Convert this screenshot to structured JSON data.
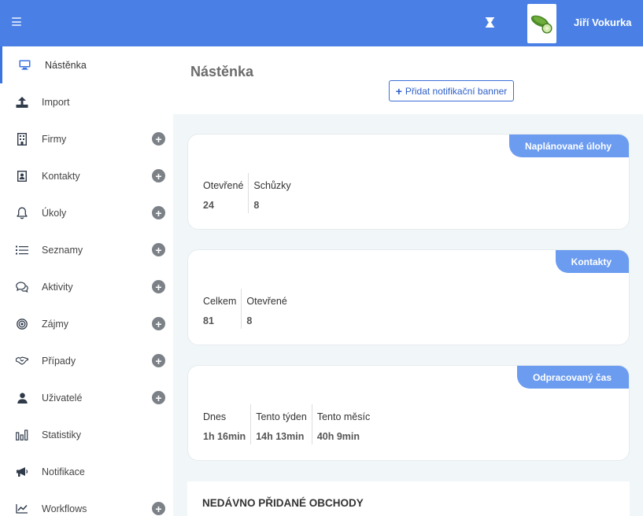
{
  "header": {
    "user_name": "Jiří Vokurka",
    "brand_color": "#4a80e6",
    "icons": [
      "menu-icon",
      "hourglass-icon",
      "avatar-cucumber-icon"
    ]
  },
  "sidebar": {
    "items": [
      {
        "label": "Nástěnka",
        "icon": "monitor-icon",
        "active": true,
        "has_add": false
      },
      {
        "label": "Import",
        "icon": "upload-icon",
        "active": false,
        "has_add": false
      },
      {
        "label": "Firmy",
        "icon": "building-icon",
        "active": false,
        "has_add": true
      },
      {
        "label": "Kontakty",
        "icon": "contact-card-icon",
        "active": false,
        "has_add": true
      },
      {
        "label": "Úkoly",
        "icon": "bell-icon",
        "active": false,
        "has_add": true
      },
      {
        "label": "Seznamy",
        "icon": "list-icon",
        "active": false,
        "has_add": true
      },
      {
        "label": "Aktivity",
        "icon": "chat-icon",
        "active": false,
        "has_add": true
      },
      {
        "label": "Zájmy",
        "icon": "target-icon",
        "active": false,
        "has_add": true
      },
      {
        "label": "Případy",
        "icon": "handshake-icon",
        "active": false,
        "has_add": true
      },
      {
        "label": "Uživatelé",
        "icon": "user-icon",
        "active": false,
        "has_add": true
      },
      {
        "label": "Statistiky",
        "icon": "bar-chart-icon",
        "active": false,
        "has_add": false
      },
      {
        "label": "Notifikace",
        "icon": "megaphone-icon",
        "active": false,
        "has_add": false
      },
      {
        "label": "Workflows",
        "icon": "line-chart-icon",
        "active": false,
        "has_add": true
      }
    ]
  },
  "main": {
    "title": "Nástěnka",
    "banner_button": {
      "icon": "plus",
      "label": "Přidat notifikační banner"
    },
    "cards": [
      {
        "tag": "Naplánované úlohy",
        "stats": [
          {
            "label": "Otevřené",
            "value": "24"
          },
          {
            "label": "Schůzky",
            "value": "8"
          }
        ]
      },
      {
        "tag": "Kontakty",
        "stats": [
          {
            "label": "Celkem",
            "value": "81"
          },
          {
            "label": "Otevřené",
            "value": "8"
          }
        ]
      },
      {
        "tag": "Odpracovaný čas",
        "stats": [
          {
            "label": "Dnes",
            "value": "1h 16min"
          },
          {
            "label": "Tento týden",
            "value": "14h 13min"
          },
          {
            "label": "Tento měsíc",
            "value": "40h 9min"
          }
        ]
      }
    ],
    "deals_title": "NEDÁVNO PŘIDANÉ OBCHODY"
  }
}
